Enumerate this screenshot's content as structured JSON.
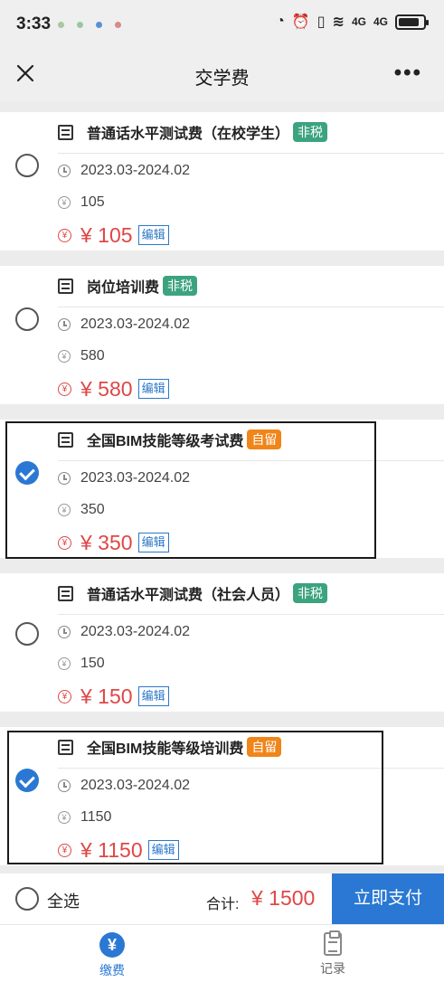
{
  "status_bar": {
    "time": "3:33",
    "network_labels": [
      "4G",
      "4G"
    ]
  },
  "header": {
    "title": "交学费",
    "close_icon": "close-icon",
    "more_icon": "more-icon"
  },
  "fees": [
    {
      "name": "普通话水平测试费（在校学生）",
      "tag": "非税",
      "tag_color": "#3ca37f",
      "period": "2023.03-2024.02",
      "amount": "105",
      "price": "¥ 105",
      "edit_label": "编辑",
      "checked": false
    },
    {
      "name": "岗位培训费",
      "tag": "非税",
      "tag_color": "#3ca37f",
      "period": "2023.03-2024.02",
      "amount": "580",
      "price": "¥ 580",
      "edit_label": "编辑",
      "checked": false
    },
    {
      "name": "全国BIM技能等级考试费",
      "tag": "自留",
      "tag_color": "#f0851a",
      "period": "2023.03-2024.02",
      "amount": "350",
      "price": "¥ 350",
      "edit_label": "编辑",
      "checked": true
    },
    {
      "name": "普通话水平测试费（社会人员）",
      "tag": "非税",
      "tag_color": "#3ca37f",
      "period": "2023.03-2024.02",
      "amount": "150",
      "price": "¥ 150",
      "edit_label": "编辑",
      "checked": false
    },
    {
      "name": "全国BIM技能等级培训费",
      "tag": "自留",
      "tag_color": "#f0851a",
      "period": "2023.03-2024.02",
      "amount": "1150",
      "price": "¥ 1150",
      "edit_label": "编辑",
      "checked": true
    }
  ],
  "footer": {
    "select_all_label": "全选",
    "total_label": "合计:",
    "total_price": "¥ 1500",
    "pay_button_label": "立即支付"
  },
  "tabbar": {
    "items": [
      {
        "label": "缴费",
        "icon": "yen-icon",
        "active": true
      },
      {
        "label": "记录",
        "icon": "clipboard-icon",
        "active": false
      }
    ]
  },
  "colors": {
    "accent": "#2a78d3",
    "price_red": "#e04646",
    "tag_green": "#3ca37f",
    "tag_orange": "#f0851a"
  }
}
